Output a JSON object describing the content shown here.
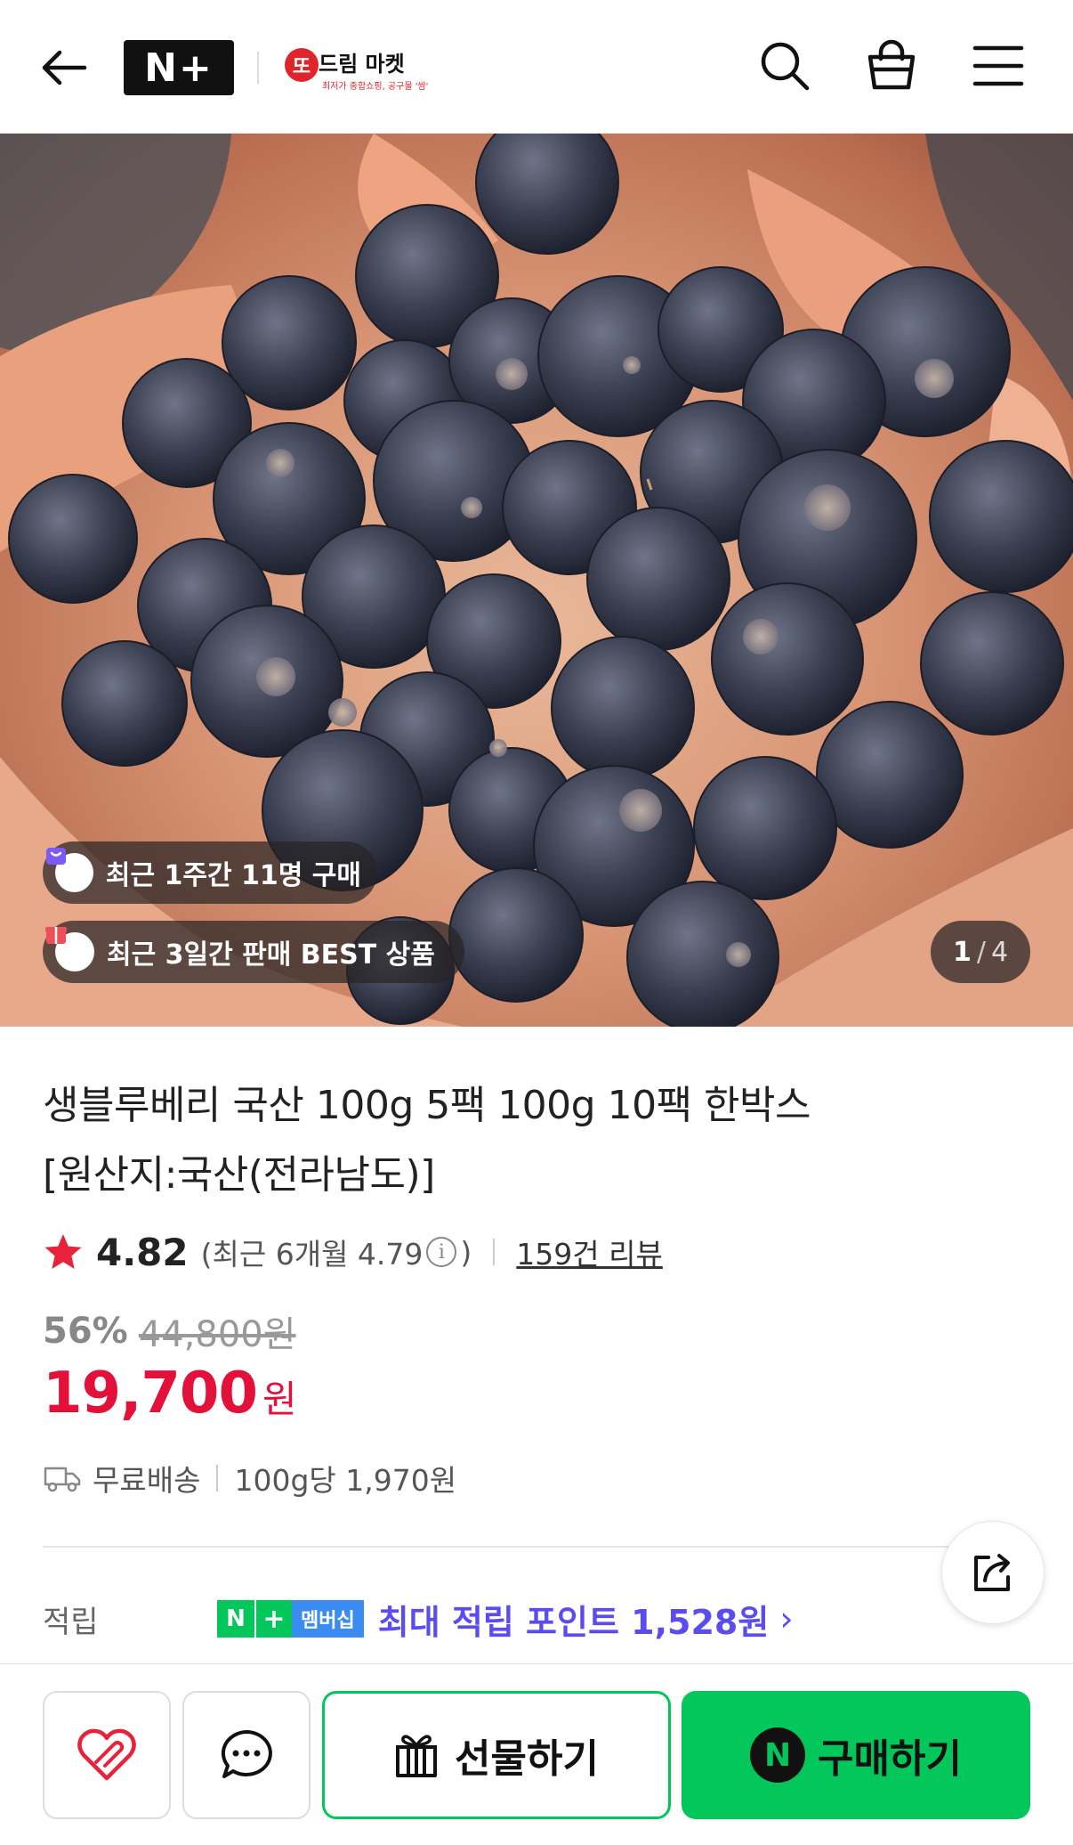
{
  "header": {
    "logo_text": "N+",
    "brand_badge": "또",
    "brand_name": "드림 마켓",
    "brand_sub": "최저가 종합쇼핑, 공구몰 '쌈'"
  },
  "hero": {
    "badges": [
      {
        "label": "최근 1주간 11명 구매"
      },
      {
        "label": "최근 3일간 판매 BEST 상품"
      }
    ],
    "pager": {
      "current": "1",
      "separator": "/",
      "total": "4"
    }
  },
  "product": {
    "title_line1": "생블루베리 국산 100g 5팩 100g 10팩 한박스",
    "title_line2": "[원산지:국산(전라남도)]",
    "rating": "4.82",
    "recent_open": "(최근 6개월 4.79",
    "recent_close": ")",
    "info_glyph": "i",
    "review_count": "159건 리뷰",
    "discount_pct": "56%",
    "original_price": "44,800원",
    "price": "19,700",
    "price_unit": "원",
    "shipping": "무료배송",
    "unit_price": "100g당 1,970원"
  },
  "points": {
    "label": "적립",
    "badge_n": "N",
    "badge_plus": "+",
    "badge_membership": "멤버십",
    "text": "최대 적립 포인트 1,528원",
    "chevron": "›"
  },
  "bottom_bar": {
    "gift_label": "선물하기",
    "buy_label": "구매하기",
    "buy_n": "N"
  },
  "colors": {
    "accent_green": "#03c75a",
    "price_red": "#e3103a",
    "point_purple": "#5b4cf0"
  }
}
